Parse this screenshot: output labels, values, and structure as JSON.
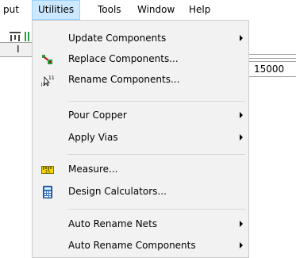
{
  "menubar": {
    "items": [
      {
        "label": "put"
      },
      {
        "label": "Utilities"
      },
      {
        "label": "Tools"
      },
      {
        "label": "Window"
      },
      {
        "label": "Help"
      }
    ]
  },
  "background": {
    "row_label": "I",
    "ruler_value": "15000"
  },
  "dropdown": {
    "items": [
      {
        "label": "Update Components",
        "icon": "none",
        "submenu": true
      },
      {
        "label": "Replace Components...",
        "icon": "replace-components-icon",
        "submenu": false
      },
      {
        "label": "Rename Components...",
        "icon": "rename-components-icon",
        "submenu": false
      },
      {
        "label": "Pour Copper",
        "icon": "none",
        "submenu": true
      },
      {
        "label": "Apply Vias",
        "icon": "none",
        "submenu": true
      },
      {
        "label": "Measure...",
        "icon": "ruler-icon",
        "submenu": false
      },
      {
        "label": "Design Calculators...",
        "icon": "calculator-icon",
        "submenu": false
      },
      {
        "label": "Auto Rename Nets",
        "icon": "none",
        "submenu": true
      },
      {
        "label": "Auto Rename Components",
        "icon": "none",
        "submenu": true
      }
    ]
  },
  "colors": {
    "menu_bg": "#f2f2f2",
    "active_menu_bg": "#cce8ff",
    "active_menu_border": "#99d1ff"
  }
}
